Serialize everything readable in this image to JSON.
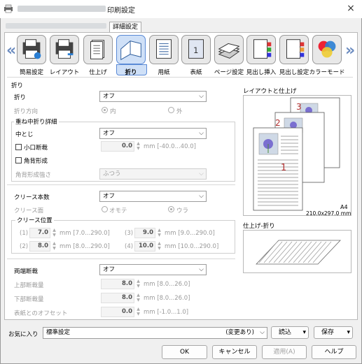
{
  "window": {
    "title": "印刷設定",
    "close_icon": "×"
  },
  "tabs": {
    "active": "詳細設定"
  },
  "nav": {
    "items": [
      {
        "label": "簡易設定",
        "icon": "quick-setup-icon"
      },
      {
        "label": "レイアウト",
        "icon": "layout-icon"
      },
      {
        "label": "仕上げ",
        "icon": "finishing-icon"
      },
      {
        "label": "折り",
        "icon": "fold-icon"
      },
      {
        "label": "用紙",
        "icon": "paper-icon"
      },
      {
        "label": "表紙",
        "icon": "cover-icon"
      },
      {
        "label": "ページ設定",
        "icon": "page-setup-icon"
      },
      {
        "label": "見出し挿入",
        "icon": "tab-insert-icon"
      },
      {
        "label": "見出し設定",
        "icon": "tab-settings-icon"
      },
      {
        "label": "カラーモード",
        "icon": "color-mode-icon"
      }
    ],
    "selected": "折り",
    "prev_arrow": "«",
    "next_arrow": "»"
  },
  "fold": {
    "section": "折り",
    "fold_label": "折り",
    "fold_value": "オフ",
    "direction_label": "折り方向",
    "dir_in": "内",
    "dir_out": "外",
    "saddle_group": "重ね中折り詳細",
    "saddle_label": "中とじ",
    "saddle_value": "オフ",
    "trim_label": "小口断裁",
    "trim_value": "0.0",
    "trim_unit": "mm [-40.0...40.0]",
    "square_label": "角背形成",
    "square_strength_label": "角背形成強さ",
    "square_strength_value": "ふつう"
  },
  "crease": {
    "count_label": "クリース本数",
    "count_value": "オフ",
    "face_label": "クリース面",
    "face_front": "オモテ",
    "face_back": "ウラ",
    "position_group": "クリース位置",
    "pos": [
      {
        "id": "(1)",
        "value": "7.0",
        "range": "mm [7.0...290.0]"
      },
      {
        "id": "(2)",
        "value": "8.0",
        "range": "mm [8.0...290.0]"
      },
      {
        "id": "(3)",
        "value": "9.0",
        "range": "mm [9.0...290.0]"
      },
      {
        "id": "(4)",
        "value": "10.0",
        "range": "mm [10.0...290.0]"
      }
    ]
  },
  "trim2": {
    "label": "両端断裁",
    "value": "オフ",
    "rows": [
      {
        "label": "上部断裁量",
        "value": "8.0",
        "range": "mm [8.0...26.0]"
      },
      {
        "label": "下部断裁量",
        "value": "8.0",
        "range": "mm [8.0...26.0]"
      },
      {
        "label": "表紙とのオフセット",
        "value": "0.0",
        "range": "mm [-1.0...1.0]"
      }
    ]
  },
  "preview": {
    "layout_label": "レイアウトと仕上げ",
    "pages": [
      "1",
      "2",
      "3"
    ],
    "paper": "A4",
    "paper_size": "210.0x297.0 mm",
    "finish_label": "仕上げ-折り"
  },
  "favorites": {
    "label": "お気に入り",
    "value": "標準設定",
    "changed": "(変更あり)",
    "load": "読込",
    "save": "保存"
  },
  "buttons": {
    "ok": "OK",
    "cancel": "キャンセル",
    "apply": "適用(A)",
    "help": "ヘルプ"
  }
}
